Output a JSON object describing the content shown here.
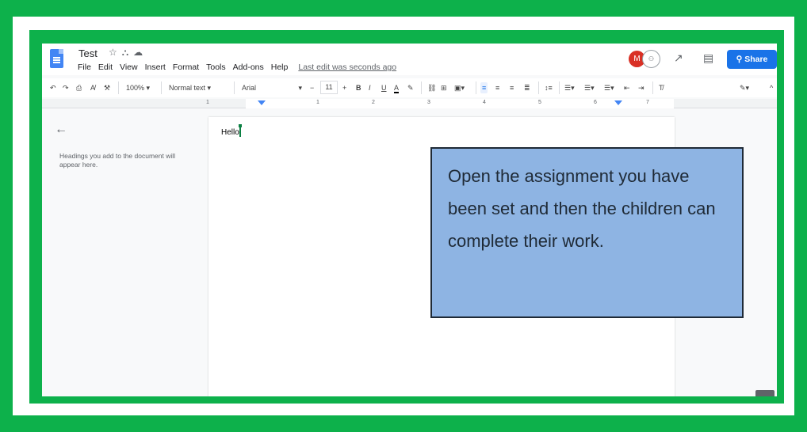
{
  "doc": {
    "title": "Test",
    "title_icons": [
      "star-icon",
      "drive-icon",
      "cloud-icon"
    ],
    "menu": [
      "File",
      "Edit",
      "View",
      "Insert",
      "Format",
      "Tools",
      "Add-ons",
      "Help"
    ],
    "last_edit": "Last edit was seconds ago",
    "avatar_initial": "M",
    "share_label": "Share"
  },
  "toolbar": {
    "zoom": "100%",
    "style": "Normal text",
    "font": "Arial",
    "font_size": "11",
    "minus": "−",
    "plus": "+"
  },
  "ruler": {
    "numbers": [
      "1",
      "1",
      "2",
      "3",
      "4",
      "5",
      "6",
      "7"
    ]
  },
  "outline": {
    "hint": "Headings you add to the document will appear here."
  },
  "page": {
    "text": "Hello"
  },
  "callout": {
    "text": "Open the assignment you have been set and then the children can complete their work."
  },
  "colors": {
    "frame": "#0db14b",
    "callout": "#8eb4e3",
    "accent": "#1a73e8"
  }
}
